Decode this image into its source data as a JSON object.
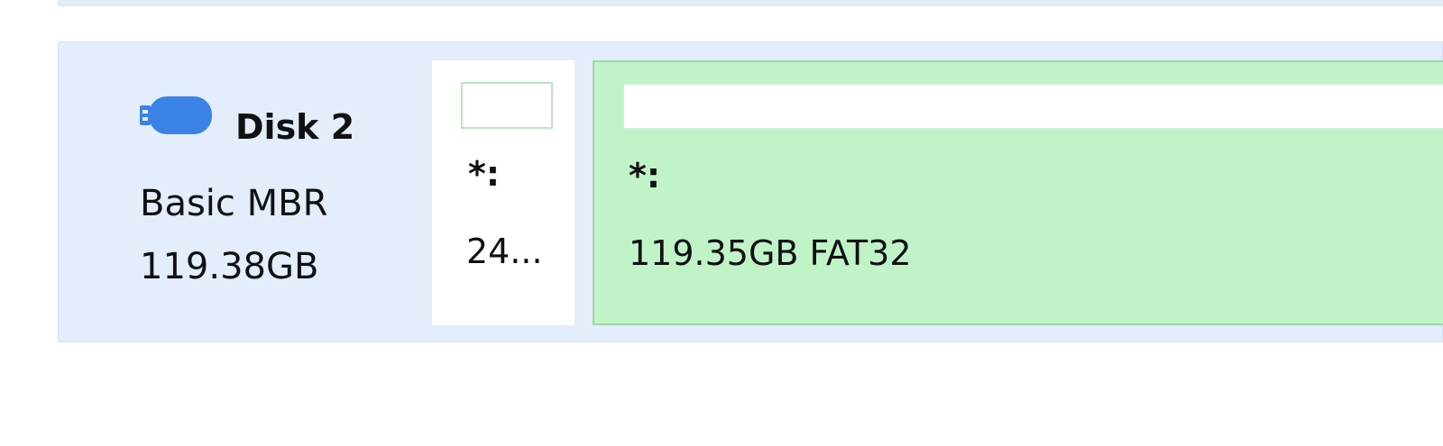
{
  "disk": {
    "name": "Disk 2",
    "type": "Basic MBR",
    "size": "119.38GB",
    "icon": "usb-drive-icon",
    "icon_color": "#3b82e6"
  },
  "partitions": [
    {
      "label": "*:",
      "info": "24..."
    },
    {
      "label": "*:",
      "info": "119.35GB FAT32",
      "color": "#c1f3c8"
    }
  ]
}
